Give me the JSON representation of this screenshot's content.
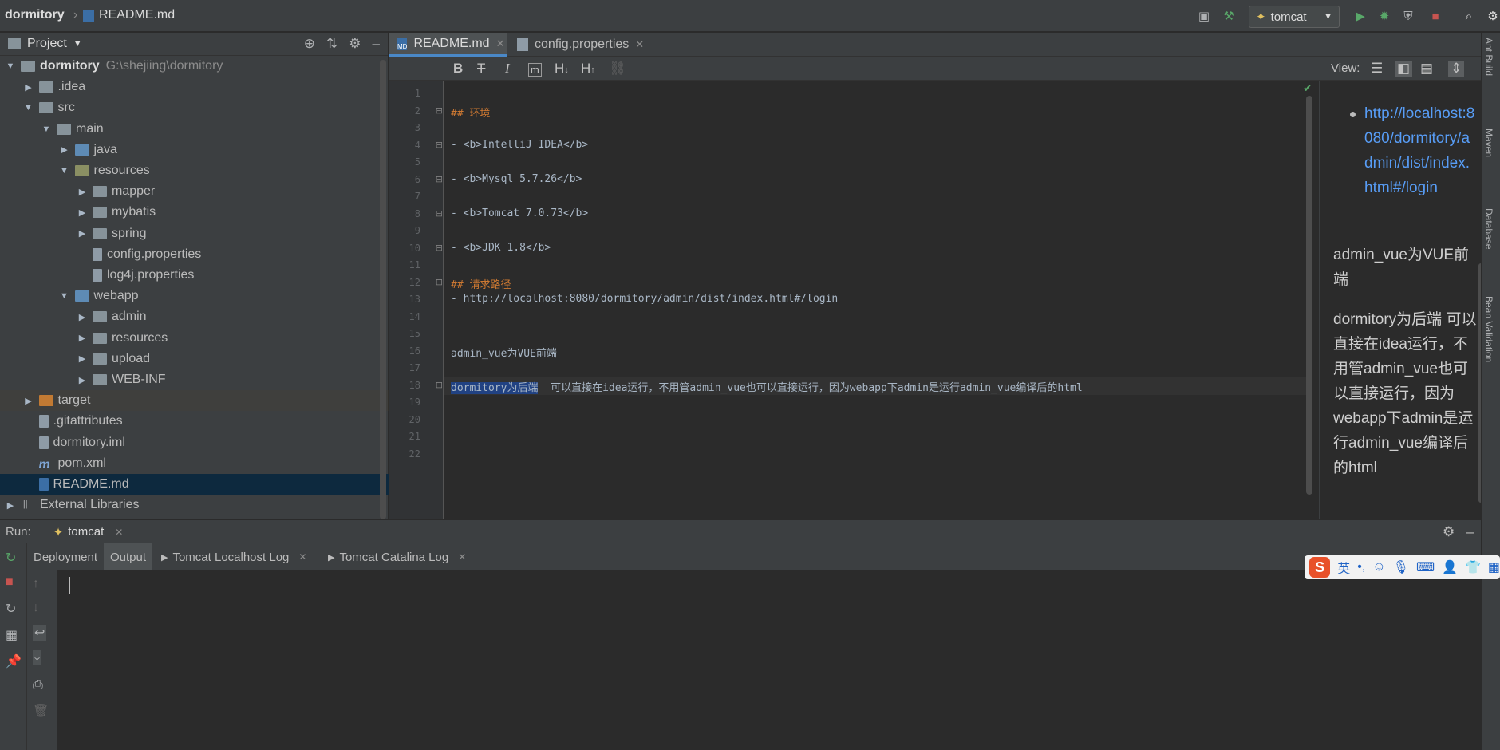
{
  "navbar": {
    "project_name": "dormitory",
    "file_name": "README.md",
    "run_config": "tomcat"
  },
  "project_panel": {
    "title": "Project",
    "tree": [
      {
        "label": "dormitory",
        "hint": "G:\\shejiing\\dormitory",
        "depth": 0,
        "expanded": true,
        "kind": "folder"
      },
      {
        "label": ".idea",
        "depth": 1,
        "expanded": false,
        "kind": "folder"
      },
      {
        "label": "src",
        "depth": 1,
        "expanded": true,
        "kind": "folder"
      },
      {
        "label": "main",
        "depth": 2,
        "expanded": true,
        "kind": "folder"
      },
      {
        "label": "java",
        "depth": 3,
        "expanded": false,
        "kind": "folder-blue"
      },
      {
        "label": "resources",
        "depth": 3,
        "expanded": true,
        "kind": "folder-res"
      },
      {
        "label": "mapper",
        "depth": 4,
        "expanded": false,
        "kind": "folder"
      },
      {
        "label": "mybatis",
        "depth": 4,
        "expanded": false,
        "kind": "folder"
      },
      {
        "label": "spring",
        "depth": 4,
        "expanded": false,
        "kind": "folder"
      },
      {
        "label": "config.properties",
        "depth": 4,
        "kind": "file"
      },
      {
        "label": "log4j.properties",
        "depth": 4,
        "kind": "file"
      },
      {
        "label": "webapp",
        "depth": 3,
        "expanded": true,
        "kind": "folder-blue"
      },
      {
        "label": "admin",
        "depth": 4,
        "expanded": false,
        "kind": "folder"
      },
      {
        "label": "resources",
        "depth": 4,
        "expanded": false,
        "kind": "folder"
      },
      {
        "label": "upload",
        "depth": 4,
        "expanded": false,
        "kind": "folder"
      },
      {
        "label": "WEB-INF",
        "depth": 4,
        "expanded": false,
        "kind": "folder"
      },
      {
        "label": "target",
        "depth": 1,
        "expanded": false,
        "kind": "folder-orange"
      },
      {
        "label": ".gitattributes",
        "depth": 1,
        "kind": "file"
      },
      {
        "label": "dormitory.iml",
        "depth": 1,
        "kind": "file"
      },
      {
        "label": "pom.xml",
        "depth": 1,
        "kind": "file-maven"
      },
      {
        "label": "README.md",
        "depth": 1,
        "kind": "file-md",
        "selected": true
      },
      {
        "label": "External Libraries",
        "depth": 0,
        "expanded": false,
        "kind": "lib"
      }
    ]
  },
  "editor": {
    "tabs": [
      {
        "label": "README.md",
        "active": true
      },
      {
        "label": "config.properties",
        "active": false
      }
    ],
    "toolbar": {
      "bold": "B",
      "strike": "T",
      "italic": "I",
      "code": "m",
      "h_down": "H",
      "h_up": "H",
      "view_label": "View:"
    },
    "lines": [
      {
        "n": "1",
        "text": ""
      },
      {
        "n": "2",
        "text": "## 环境",
        "heading": true
      },
      {
        "n": "3",
        "text": ""
      },
      {
        "n": "4",
        "text": "- <b>IntelliJ IDEA</b>"
      },
      {
        "n": "5",
        "text": ""
      },
      {
        "n": "6",
        "text": "- <b>Mysql 5.7.26</b>"
      },
      {
        "n": "7",
        "text": ""
      },
      {
        "n": "8",
        "text": "- <b>Tomcat 7.0.73</b>"
      },
      {
        "n": "9",
        "text": ""
      },
      {
        "n": "10",
        "text": "- <b>JDK 1.8</b>"
      },
      {
        "n": "11",
        "text": ""
      },
      {
        "n": "12",
        "text": "## 请求路径",
        "heading": true
      },
      {
        "n": "13",
        "text": "- http://localhost:8080/dormitory/admin/dist/index.html#/login"
      },
      {
        "n": "14",
        "text": ""
      },
      {
        "n": "15",
        "text": ""
      },
      {
        "n": "16",
        "text": "admin_vue为VUE前端"
      },
      {
        "n": "17",
        "text": ""
      },
      {
        "n": "18",
        "sel": "dormitory为后端",
        "text": "  可以直接在idea运行，不用管admin_vue也可以直接运行，因为webapp下admin是运行admin_vue编译后的html",
        "current": true
      },
      {
        "n": "19",
        "text": ""
      },
      {
        "n": "20",
        "text": ""
      },
      {
        "n": "21",
        "text": ""
      },
      {
        "n": "22",
        "text": ""
      }
    ]
  },
  "preview": {
    "link": "http://localhost:8080/dormitory/admin/dist/index.html#/login",
    "para1": "admin_vue为VUE前端",
    "para2": "dormitory为后端 可以直接在idea运行，不用管admin_vue也可以直接运行，因为webapp下admin是运行admin_vue编译后的html"
  },
  "right_strip": [
    "Ant Build",
    "Maven",
    "Database",
    "Bean Validation"
  ],
  "run_panel": {
    "label": "Run:",
    "config": "tomcat",
    "tabs": [
      {
        "label": "Deployment",
        "active": false
      },
      {
        "label": "Output",
        "active": true
      },
      {
        "label": "Tomcat Localhost Log",
        "active": false
      },
      {
        "label": "Tomcat Catalina Log",
        "active": false
      }
    ]
  },
  "ime": {
    "logo": "S",
    "lang": "英"
  },
  "colors": {
    "accent": "#4a88c7",
    "link": "#589df6",
    "run_green": "#59a869",
    "stop_red": "#c75450"
  }
}
